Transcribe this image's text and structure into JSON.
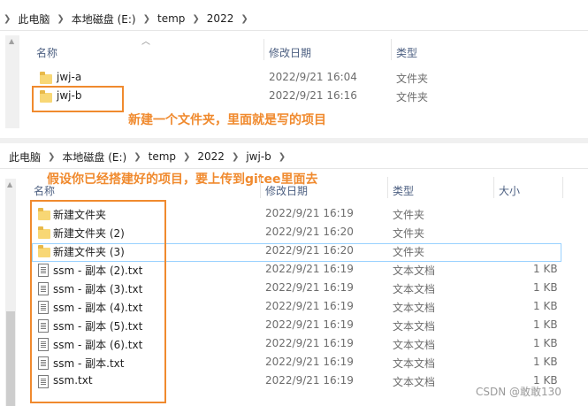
{
  "top": {
    "breadcrumbs": [
      "此电脑",
      "本地磁盘 (E:)",
      "temp",
      "2022"
    ],
    "columns": [
      "名称",
      "修改日期",
      "类型"
    ],
    "rows": [
      {
        "name": "jwj-a",
        "date": "2022/9/21 16:04",
        "type": "文件夹"
      },
      {
        "name": "jwj-b",
        "date": "2022/9/21 16:16",
        "type": "文件夹"
      }
    ],
    "annotation": "新建一个文件夹，里面就是写的项目"
  },
  "bottom": {
    "breadcrumbs": [
      "此电脑",
      "本地磁盘 (E:)",
      "temp",
      "2022",
      "jwj-b"
    ],
    "columns": [
      "名称",
      "修改日期",
      "类型",
      "大小"
    ],
    "annotation": "假设你已经搭建好的项目，要上传到gitee里面去",
    "rows": [
      {
        "name": "新建文件夹",
        "date": "2022/9/21 16:19",
        "type": "文件夹",
        "size": "",
        "icon": "folder"
      },
      {
        "name": "新建文件夹 (2)",
        "date": "2022/9/21 16:20",
        "type": "文件夹",
        "size": "",
        "icon": "folder"
      },
      {
        "name": "新建文件夹 (3)",
        "date": "2022/9/21 16:20",
        "type": "文件夹",
        "size": "",
        "icon": "folder"
      },
      {
        "name": "ssm - 副本 (2).txt",
        "date": "2022/9/21 16:19",
        "type": "文本文档",
        "size": "1 KB",
        "icon": "doc"
      },
      {
        "name": "ssm - 副本 (3).txt",
        "date": "2022/9/21 16:19",
        "type": "文本文档",
        "size": "1 KB",
        "icon": "doc"
      },
      {
        "name": "ssm - 副本 (4).txt",
        "date": "2022/9/21 16:19",
        "type": "文本文档",
        "size": "1 KB",
        "icon": "doc"
      },
      {
        "name": "ssm - 副本 (5).txt",
        "date": "2022/9/21 16:19",
        "type": "文本文档",
        "size": "1 KB",
        "icon": "doc"
      },
      {
        "name": "ssm - 副本 (6).txt",
        "date": "2022/9/21 16:19",
        "type": "文本文档",
        "size": "1 KB",
        "icon": "doc"
      },
      {
        "name": "ssm - 副本.txt",
        "date": "2022/9/21 16:19",
        "type": "文本文档",
        "size": "1 KB",
        "icon": "doc"
      },
      {
        "name": "ssm.txt",
        "date": "2022/9/21 16:19",
        "type": "文本文档",
        "size": "1 KB",
        "icon": "doc"
      }
    ]
  },
  "watermark": "CSDN @敢敢130",
  "colors": {
    "accent": "#f08a2e",
    "header_text": "#4d6082",
    "folder": "#f8d775"
  }
}
